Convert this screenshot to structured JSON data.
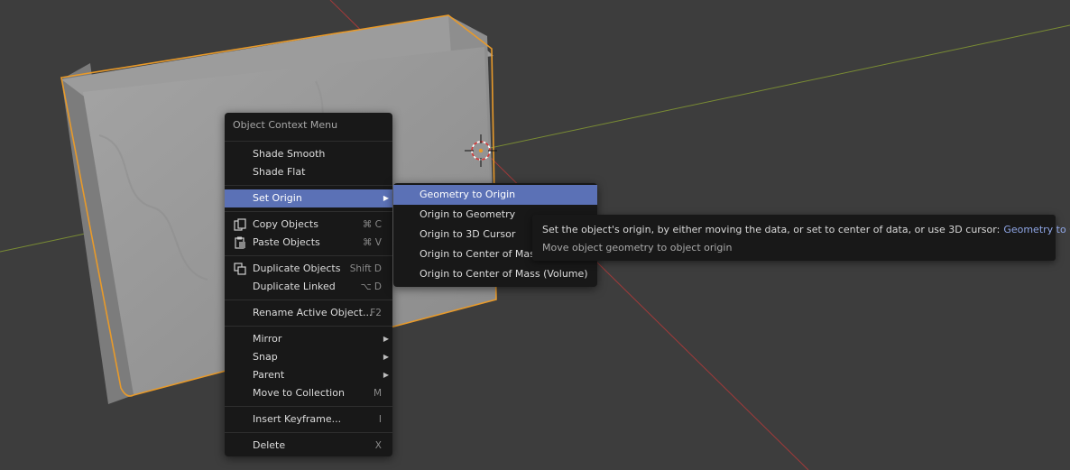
{
  "context_menu": {
    "title": "Object Context Menu",
    "shade_smooth": "Shade Smooth",
    "shade_flat": "Shade Flat",
    "set_origin": "Set Origin",
    "copy_objects": "Copy Objects",
    "copy_shortcut": "⌘ C",
    "paste_objects": "Paste Objects",
    "paste_shortcut": "⌘ V",
    "duplicate_objects": "Duplicate Objects",
    "duplicate_shortcut": "Shift D",
    "duplicate_linked": "Duplicate Linked",
    "duplicate_linked_shortcut": "⌥ D",
    "rename_active": "Rename Active Object...",
    "rename_shortcut": "F2",
    "mirror": "Mirror",
    "snap": "Snap",
    "parent": "Parent",
    "move_to_collection": "Move to Collection",
    "move_shortcut": "M",
    "insert_keyframe": "Insert Keyframe...",
    "insert_keyframe_shortcut": "I",
    "delete": "Delete",
    "delete_shortcut": "X"
  },
  "set_origin_submenu": {
    "items": [
      "Geometry to Origin",
      "Origin to Geometry",
      "Origin to 3D Cursor",
      "Origin to Center of Mass (Surface)",
      "Origin to Center of Mass (Volume)"
    ]
  },
  "tooltip": {
    "description": "Set the object's origin, by either moving the data, or set to center of data, or use 3D cursor:",
    "operator": "Geometry to Origin",
    "detail": "Move object geometry to object origin"
  },
  "icons": {
    "copy": "copy-icon",
    "paste": "paste-icon",
    "duplicate": "duplicate-icon",
    "cursor": "3d-cursor-icon"
  },
  "colors": {
    "viewport_bg": "#3d3d3d",
    "menu_bg": "#181818",
    "highlight": "#5b71b6",
    "selection_outline": "#e89a2a",
    "x_axis": "#a23a3a",
    "y_axis": "#7a8c34"
  }
}
